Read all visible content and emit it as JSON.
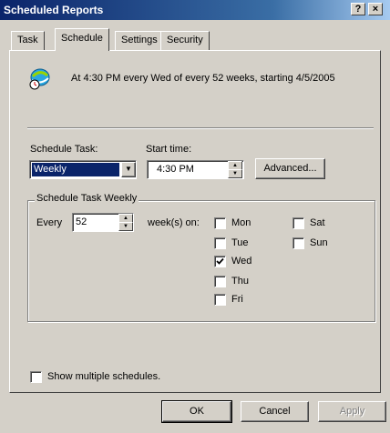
{
  "window": {
    "title": "Scheduled Reports",
    "help_glyph": "?",
    "close_glyph": "×"
  },
  "tabs": [
    {
      "label": "Task"
    },
    {
      "label": "Schedule"
    },
    {
      "label": "Settings"
    },
    {
      "label": "Security"
    }
  ],
  "summary": {
    "text": "At 4:30 PM every Wed of every 52 weeks, starting 4/5/2005",
    "icon": "calendar-clock-icon"
  },
  "schedule_task": {
    "label": "Schedule Task:",
    "value": "Weekly"
  },
  "start_time": {
    "label": "Start time:",
    "value": "4:30 PM"
  },
  "advanced_button": "Advanced...",
  "weekly_group": {
    "title": "Schedule Task Weekly",
    "every_label": "Every",
    "every_value": "52",
    "weeks_on_label": "week(s) on:",
    "days": [
      {
        "label": "Mon",
        "checked": false
      },
      {
        "label": "Tue",
        "checked": false
      },
      {
        "label": "Wed",
        "checked": true
      },
      {
        "label": "Thu",
        "checked": false
      },
      {
        "label": "Fri",
        "checked": false
      },
      {
        "label": "Sat",
        "checked": false
      },
      {
        "label": "Sun",
        "checked": false
      }
    ]
  },
  "show_multiple": {
    "label": "Show multiple schedules.",
    "checked": false
  },
  "buttons": {
    "ok": "OK",
    "cancel": "Cancel",
    "apply": "Apply"
  },
  "colors": {
    "face": "#d4d0c8",
    "selection": "#0a246a",
    "title_start": "#0a246a"
  }
}
